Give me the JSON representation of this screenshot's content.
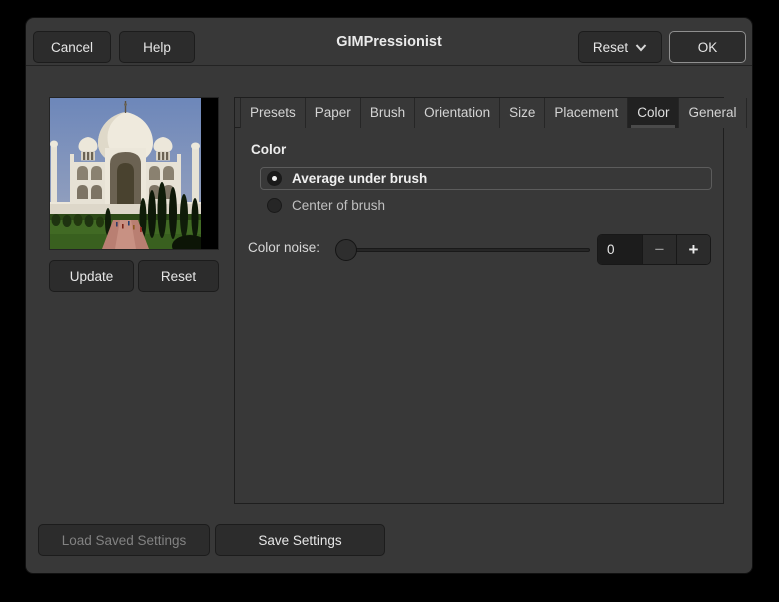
{
  "window": {
    "title": "GIMPressionist"
  },
  "header": {
    "cancel_label": "Cancel",
    "help_label": "Help",
    "reset_menu_label": "Reset",
    "ok_label": "OK"
  },
  "preview": {
    "image_description": "Taj Mahal photograph preview",
    "update_label": "Update",
    "reset_label": "Reset"
  },
  "tabs": [
    {
      "label": "Presets"
    },
    {
      "label": "Paper"
    },
    {
      "label": "Brush"
    },
    {
      "label": "Orientation"
    },
    {
      "label": "Size"
    },
    {
      "label": "Placement"
    },
    {
      "label": "Color",
      "selected": true
    },
    {
      "label": "General"
    }
  ],
  "color_panel": {
    "heading": "Color",
    "options": [
      {
        "label": "Average under brush",
        "selected": true
      },
      {
        "label": "Center of brush",
        "selected": false
      }
    ],
    "noise_label": "Color noise:",
    "noise_value": "0",
    "minus_glyph": "−",
    "plus_glyph": "+"
  },
  "footer": {
    "load_label": "Load Saved Settings",
    "save_label": "Save Settings"
  },
  "colors": {
    "dialog_bg": "#383838",
    "button_bg": "#2c2c2c",
    "entry_bg": "#1c1c1c",
    "selected_tab_bg": "#212121",
    "border": "#1e1e1e",
    "text": "#e6e6e6"
  }
}
